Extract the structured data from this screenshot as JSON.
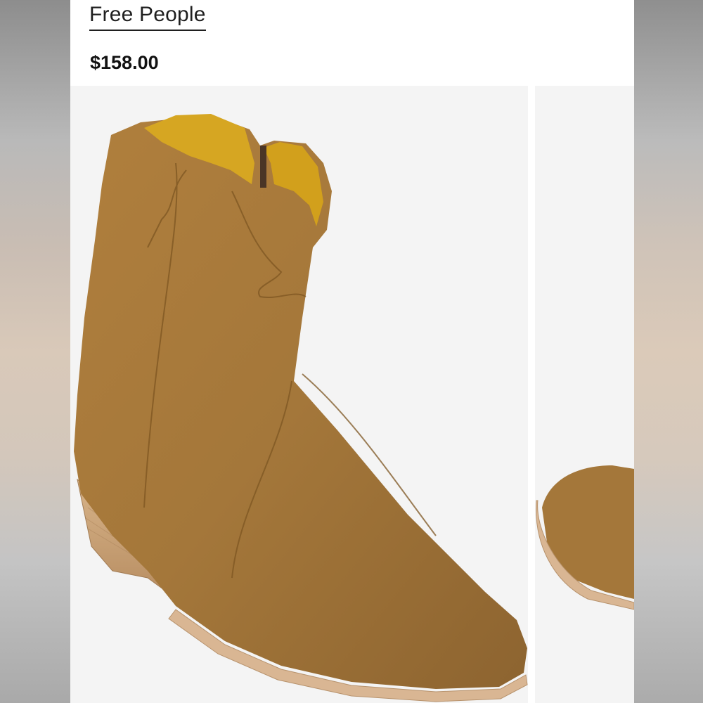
{
  "product": {
    "brand": "Free People",
    "price": "$158.00"
  },
  "gallery": {
    "images": [
      {
        "subject": "tan suede western ankle boot, side view"
      },
      {
        "subject": "tan suede western ankle boot, toe view"
      }
    ]
  },
  "colors": {
    "suede": "#a4773a",
    "suede_dark": "#8a6128",
    "lining": "#d6a622",
    "heel_wood": "#c9a27a",
    "welt": "#d9b693",
    "background": "#f4f4f4"
  }
}
